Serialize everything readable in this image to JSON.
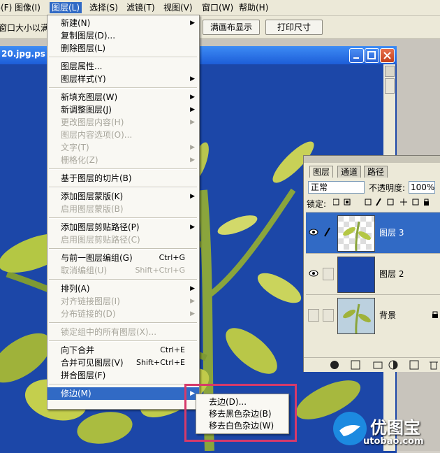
{
  "menubar": {
    "items": [
      {
        "label": "文件(F)"
      },
      {
        "label": "图像(I)"
      },
      {
        "label": "图层(L)"
      },
      {
        "label": "选择(S)"
      },
      {
        "label": "滤镜(T)"
      },
      {
        "label": "视图(V)"
      },
      {
        "label": "窗口(W)"
      },
      {
        "label": "帮助(H)"
      }
    ]
  },
  "toolbar": {
    "fit_text": "窗口大小以满屏",
    "fill_canvas_label": "满画布显示",
    "print_size_label": "打印尺寸"
  },
  "document": {
    "title": "20.jpg.ps"
  },
  "layer_menu": {
    "items": [
      {
        "label": "新建(N)",
        "submenu": true
      },
      {
        "label": "复制图层(D)..."
      },
      {
        "label": "删除图层(L)"
      },
      {
        "sep": true
      },
      {
        "label": "图层属性..."
      },
      {
        "label": "图层样式(Y)",
        "submenu": true
      },
      {
        "sep": true
      },
      {
        "label": "新填充图层(W)",
        "submenu": true
      },
      {
        "label": "新调整图层(J)",
        "submenu": true
      },
      {
        "label": "更改图层内容(H)",
        "submenu": true,
        "disabled": true
      },
      {
        "label": "图层内容选项(O)...",
        "disabled": true
      },
      {
        "label": "文字(T)",
        "submenu": true,
        "disabled": true
      },
      {
        "label": "栅格化(Z)",
        "submenu": true,
        "disabled": true
      },
      {
        "sep": true
      },
      {
        "label": "基于图层的切片(B)"
      },
      {
        "sep": true
      },
      {
        "label": "添加图层蒙版(K)",
        "submenu": true
      },
      {
        "label": "启用图层蒙版(B)",
        "disabled": true
      },
      {
        "sep": true
      },
      {
        "label": "添加图层剪贴路径(P)",
        "submenu": true
      },
      {
        "label": "启用图层剪贴路径(C)",
        "disabled": true
      },
      {
        "sep": true
      },
      {
        "label": "与前一图层编组(G)",
        "shortcut": "Ctrl+G"
      },
      {
        "label": "取消编组(U)",
        "shortcut": "Shift+Ctrl+G",
        "disabled": true
      },
      {
        "sep": true
      },
      {
        "label": "排列(A)",
        "submenu": true
      },
      {
        "label": "对齐链接图层(I)",
        "submenu": true,
        "disabled": true
      },
      {
        "label": "分布链接的(D)",
        "submenu": true,
        "disabled": true
      },
      {
        "sep": true
      },
      {
        "label": "锁定组中的所有图层(X)...",
        "disabled": true
      },
      {
        "sep": true
      },
      {
        "label": "向下合并",
        "shortcut": "Ctrl+E"
      },
      {
        "label": "合并可见图层(V)",
        "shortcut": "Shift+Ctrl+E"
      },
      {
        "label": "拼合图层(F)"
      },
      {
        "sep": true
      },
      {
        "label": "修边(M)",
        "submenu": true,
        "highlighted": true
      }
    ]
  },
  "matting_submenu": {
    "items": [
      {
        "label": "去边(D)..."
      },
      {
        "label": "移去黑色杂边(B)"
      },
      {
        "label": "移去白色杂边(W)"
      }
    ]
  },
  "layers_panel": {
    "tabs": [
      "图层",
      "通道",
      "路径"
    ],
    "blend_mode": "正常",
    "opacity_label": "不透明度:",
    "opacity_value": "100%",
    "lock_label": "锁定:",
    "layers": [
      {
        "name": "图层 3",
        "selected": true,
        "visible": true
      },
      {
        "name": "图层 2",
        "selected": false,
        "visible": true
      },
      {
        "name": "背景",
        "selected": false,
        "visible": false
      }
    ]
  },
  "watermark": {
    "text": "优图宝",
    "url": "utobao.com"
  },
  "colors": {
    "canvas_blue": "#1c47a8",
    "highlight": "#316ac5",
    "red_box": "#d63a6a"
  }
}
